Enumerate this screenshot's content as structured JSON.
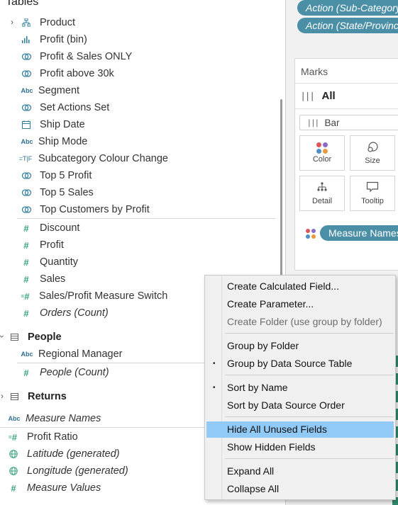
{
  "data_pane": {
    "header": "Tables",
    "fields": [
      {
        "label": "Product",
        "icon": "hierarchy-icon"
      },
      {
        "label": "Profit (bin)",
        "icon": "bin-icon"
      },
      {
        "label": "Profit & Sales ONLY",
        "icon": "set-icon"
      },
      {
        "label": "Profit above 30k",
        "icon": "set-icon"
      },
      {
        "label": "Segment",
        "icon": "abc-icon",
        "icon_text": "Abc"
      },
      {
        "label": "Set Actions Set",
        "icon": "set-icon"
      },
      {
        "label": "Ship Date",
        "icon": "calendar-icon"
      },
      {
        "label": "Ship Mode",
        "icon": "abc-icon",
        "icon_text": "Abc"
      },
      {
        "label": "Subcategory Colour Change",
        "icon": "boolean-icon",
        "icon_text": "=T|F"
      },
      {
        "label": "Top 5 Profit",
        "icon": "set-icon"
      },
      {
        "label": "Top 5 Sales",
        "icon": "set-icon"
      },
      {
        "label": "Top Customers by Profit",
        "icon": "set-icon"
      }
    ],
    "measures": [
      {
        "label": "Discount",
        "icon": "number-icon"
      },
      {
        "label": "Profit",
        "icon": "number-icon"
      },
      {
        "label": "Quantity",
        "icon": "number-icon"
      },
      {
        "label": "Sales",
        "icon": "number-icon"
      },
      {
        "label": "Sales/Profit Measure Switch",
        "icon": "calc-number-icon"
      },
      {
        "label": "Orders (Count)",
        "icon": "number-icon"
      }
    ],
    "people": {
      "title": "People",
      "regional_manager": "Regional Manager",
      "people_count": "People (Count)"
    },
    "returns": {
      "title": "Returns"
    },
    "bottom_fields": {
      "measure_names": "Measure Names",
      "profit_ratio": "Profit Ratio",
      "latitude": "Latitude (generated)",
      "longitude": "Longitude (generated)",
      "measure_values": "Measure Values"
    },
    "abc_text": "Abc"
  },
  "right_panel": {
    "filters": [
      "Action (Sub-Category)",
      "Action (State/Province)"
    ],
    "marks": {
      "title": "Marks",
      "all_label": "All",
      "mark_type": "Bar",
      "buttons": {
        "color": "Color",
        "size": "Size",
        "detail": "Detail",
        "tooltip": "Tooltip"
      },
      "measure_pill": "Measure Names"
    },
    "colors": {
      "pill": "#4b8fa6",
      "strip": "#2e8b6e"
    }
  },
  "context_menu": {
    "items": {
      "create_calculated_field": "Create Calculated Field...",
      "create_parameter": "Create Parameter...",
      "create_folder": "Create Folder (use group by folder)",
      "group_by_folder": "Group by Folder",
      "group_by_data_source_table": "Group by Data Source Table",
      "sort_by_name": "Sort by Name",
      "sort_by_data_source_order": "Sort by Data Source Order",
      "hide_all_unused_fields": "Hide All Unused Fields",
      "show_hidden_fields": "Show Hidden Fields",
      "expand_all": "Expand All",
      "collapse_all": "Collapse All"
    },
    "highlight_color": "#91c9f7"
  }
}
